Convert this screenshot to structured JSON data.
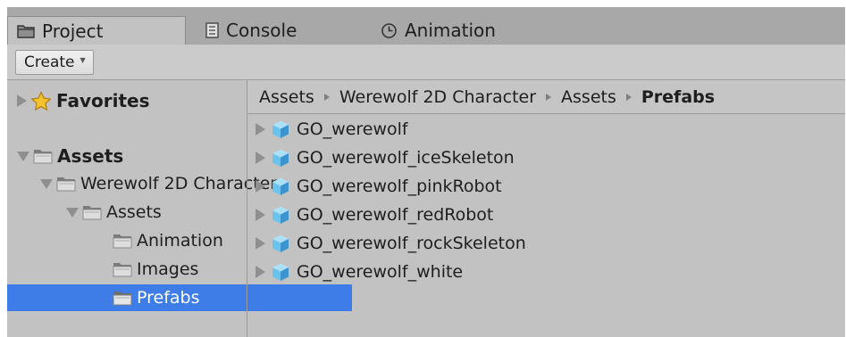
{
  "tabs": [
    {
      "label": "Project",
      "icon": "folder-icon",
      "active": true
    },
    {
      "label": "Console",
      "icon": "console-icon",
      "active": false
    },
    {
      "label": "Animation",
      "icon": "clock-icon",
      "active": false
    }
  ],
  "toolbar": {
    "create_label": "Create"
  },
  "tree": {
    "favorites": "Favorites",
    "assets": "Assets",
    "werewolf_folder": "Werewolf 2D Character",
    "sub_assets": "Assets",
    "animation": "Animation",
    "images": "Images",
    "prefabs": "Prefabs",
    "selected": "Prefabs"
  },
  "breadcrumb": [
    "Assets",
    "Werewolf 2D Character",
    "Assets",
    "Prefabs"
  ],
  "prefabs": [
    "GO_werewolf",
    "GO_werewolf_iceSkeleton",
    "GO_werewolf_pinkRobot",
    "GO_werewolf_redRobot",
    "GO_werewolf_rockSkeleton",
    "GO_werewolf_white"
  ],
  "colors": {
    "selection": "#3e7de7",
    "panel": "#c2c2c2",
    "tabbar": "#a8a8a8",
    "star": "#f5c22e",
    "prefab_cube": "#6ec3ec"
  }
}
